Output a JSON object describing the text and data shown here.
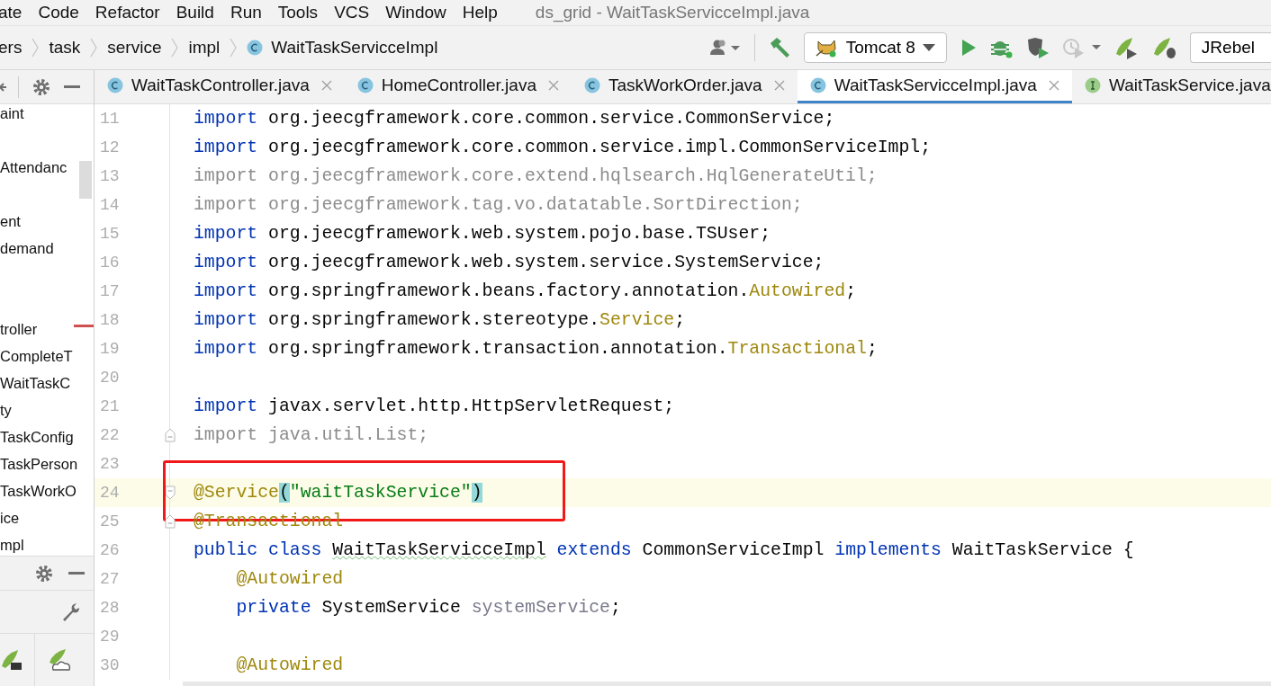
{
  "menu": [
    {
      "label": "ate"
    },
    {
      "label": "Code"
    },
    {
      "label": "Refactor"
    },
    {
      "label": "Build"
    },
    {
      "label": "Run"
    },
    {
      "label": "Tools"
    },
    {
      "label": "VCS"
    },
    {
      "label": "Window"
    },
    {
      "label": "Help"
    }
  ],
  "window": {
    "title": "ds_grid - WaitTaskServicceImpl.java"
  },
  "breadcrumb": [
    {
      "label": "ers",
      "kind": "folder"
    },
    {
      "label": "task",
      "kind": "folder"
    },
    {
      "label": "service",
      "kind": "folder"
    },
    {
      "label": "impl",
      "kind": "folder"
    },
    {
      "label": "WaitTaskServicceImpl",
      "kind": "class"
    }
  ],
  "run_config": {
    "label": "Tomcat 8"
  },
  "jrebel": {
    "label": "JRebel"
  },
  "tabs": [
    {
      "label": "WaitTaskController.java",
      "kind": "class",
      "selected": false,
      "closable": true
    },
    {
      "label": "HomeController.java",
      "kind": "class",
      "selected": false,
      "closable": true
    },
    {
      "label": "TaskWorkOrder.java",
      "kind": "class",
      "selected": false,
      "closable": true
    },
    {
      "label": "WaitTaskServicceImpl.java",
      "kind": "class",
      "selected": true,
      "closable": true
    },
    {
      "label": "WaitTaskService.java",
      "kind": "interface",
      "selected": false,
      "closable": false
    }
  ],
  "project_tree": [
    {
      "label": "aint"
    },
    {
      "label": "Attendanc"
    },
    {
      "label": "ent"
    },
    {
      "label": "demand"
    },
    {
      "label": "troller"
    },
    {
      "label": "CompleteT"
    },
    {
      "label": "WaitTaskC"
    },
    {
      "label": "ty"
    },
    {
      "label": "TaskConfig"
    },
    {
      "label": "TaskPerson"
    },
    {
      "label": "TaskWorkO"
    },
    {
      "label": "ice"
    },
    {
      "label": "mpl"
    }
  ],
  "code": [
    {
      "number": "11",
      "current": false,
      "fold_start": false,
      "fold_end": false,
      "tokens": [
        {
          "text": "import ",
          "kind": "kw"
        },
        {
          "text": "org.jeecgframework.core.common.service.CommonService;",
          "kind": "plain"
        }
      ]
    },
    {
      "number": "12",
      "current": false,
      "fold_start": false,
      "fold_end": false,
      "tokens": [
        {
          "text": "import ",
          "kind": "kw"
        },
        {
          "text": "org.jeecgframework.core.common.service.impl.CommonServiceImpl;",
          "kind": "plain"
        }
      ]
    },
    {
      "number": "13",
      "current": false,
      "fold_start": false,
      "fold_end": false,
      "tokens": [
        {
          "text": "import org.jeecgframework.core.extend.hqlsearch.HqlGenerateUtil;",
          "kind": "unused"
        }
      ]
    },
    {
      "number": "14",
      "current": false,
      "fold_start": false,
      "fold_end": false,
      "tokens": [
        {
          "text": "import org.jeecgframework.tag.vo.datatable.SortDirection;",
          "kind": "unused"
        }
      ]
    },
    {
      "number": "15",
      "current": false,
      "fold_start": false,
      "fold_end": false,
      "tokens": [
        {
          "text": "import ",
          "kind": "kw"
        },
        {
          "text": "org.jeecgframework.web.system.pojo.base.TSUser;",
          "kind": "plain"
        }
      ]
    },
    {
      "number": "16",
      "current": false,
      "fold_start": false,
      "fold_end": false,
      "tokens": [
        {
          "text": "import ",
          "kind": "kw"
        },
        {
          "text": "org.jeecgframework.web.system.service.SystemService;",
          "kind": "plain"
        }
      ]
    },
    {
      "number": "17",
      "current": false,
      "fold_start": false,
      "fold_end": false,
      "tokens": [
        {
          "text": "import ",
          "kind": "kw"
        },
        {
          "text": "org.springframework.beans.factory.annotation.",
          "kind": "plain"
        },
        {
          "text": "Autowired",
          "kind": "anno"
        },
        {
          "text": ";",
          "kind": "plain"
        }
      ]
    },
    {
      "number": "18",
      "current": false,
      "fold_start": false,
      "fold_end": false,
      "tokens": [
        {
          "text": "import ",
          "kind": "kw"
        },
        {
          "text": "org.springframework.stereotype.",
          "kind": "plain"
        },
        {
          "text": "Service",
          "kind": "anno"
        },
        {
          "text": ";",
          "kind": "plain"
        }
      ]
    },
    {
      "number": "19",
      "current": false,
      "fold_start": false,
      "fold_end": false,
      "tokens": [
        {
          "text": "import ",
          "kind": "kw"
        },
        {
          "text": "org.springframework.transaction.annotation.",
          "kind": "plain"
        },
        {
          "text": "Transactional",
          "kind": "anno"
        },
        {
          "text": ";",
          "kind": "plain"
        }
      ]
    },
    {
      "number": "20",
      "current": false,
      "fold_start": false,
      "fold_end": false
    },
    {
      "number": "21",
      "current": false,
      "fold_start": false,
      "fold_end": false,
      "tokens": [
        {
          "text": "import ",
          "kind": "kw"
        },
        {
          "text": "javax.servlet.http.HttpServletRequest;",
          "kind": "plain"
        }
      ]
    },
    {
      "number": "22",
      "current": false,
      "fold_start": false,
      "fold_end": true,
      "tokens": [
        {
          "text": "import java.util.List;",
          "kind": "unused"
        }
      ]
    },
    {
      "number": "23",
      "current": false,
      "fold_start": false,
      "fold_end": false
    },
    {
      "number": "24",
      "current": true,
      "fold_start": true,
      "fold_end": false,
      "tokens": [
        {
          "text": "@Service",
          "kind": "anno"
        },
        {
          "text": "(",
          "kind": "brace"
        },
        {
          "text": "\"waitTaskService\"",
          "kind": "string"
        },
        {
          "text": ")",
          "kind": "brace"
        }
      ]
    },
    {
      "number": "25",
      "current": false,
      "fold_start": false,
      "fold_end": true,
      "tokens": [
        {
          "text": "@Transactional",
          "kind": "anno"
        }
      ]
    },
    {
      "number": "26",
      "current": false,
      "fold_start": false,
      "fold_end": false,
      "tokens": [
        {
          "text": "public class ",
          "kind": "kw"
        },
        {
          "text": "WaitTaskServicceImpl",
          "kind": "typo"
        },
        {
          "text": " extends ",
          "kind": "kw"
        },
        {
          "text": "CommonServiceImpl ",
          "kind": "plain"
        },
        {
          "text": "implements ",
          "kind": "kw"
        },
        {
          "text": "WaitTaskService {",
          "kind": "plain"
        }
      ]
    },
    {
      "number": "27",
      "current": false,
      "fold_start": false,
      "fold_end": false,
      "tokens": [
        {
          "text": "    @Autowired",
          "kind": "anno"
        }
      ]
    },
    {
      "number": "28",
      "current": false,
      "fold_start": false,
      "fold_end": false,
      "tokens": [
        {
          "text": "    private ",
          "kind": "kw"
        },
        {
          "text": "SystemService ",
          "kind": "plain"
        },
        {
          "text": "systemService",
          "kind": "field"
        },
        {
          "text": ";",
          "kind": "plain"
        }
      ]
    },
    {
      "number": "29",
      "current": false,
      "fold_start": false,
      "fold_end": false
    },
    {
      "number": "30",
      "current": false,
      "fold_start": false,
      "fold_end": false,
      "tokens": [
        {
          "text": "    @Autowired",
          "kind": "anno"
        }
      ]
    }
  ]
}
